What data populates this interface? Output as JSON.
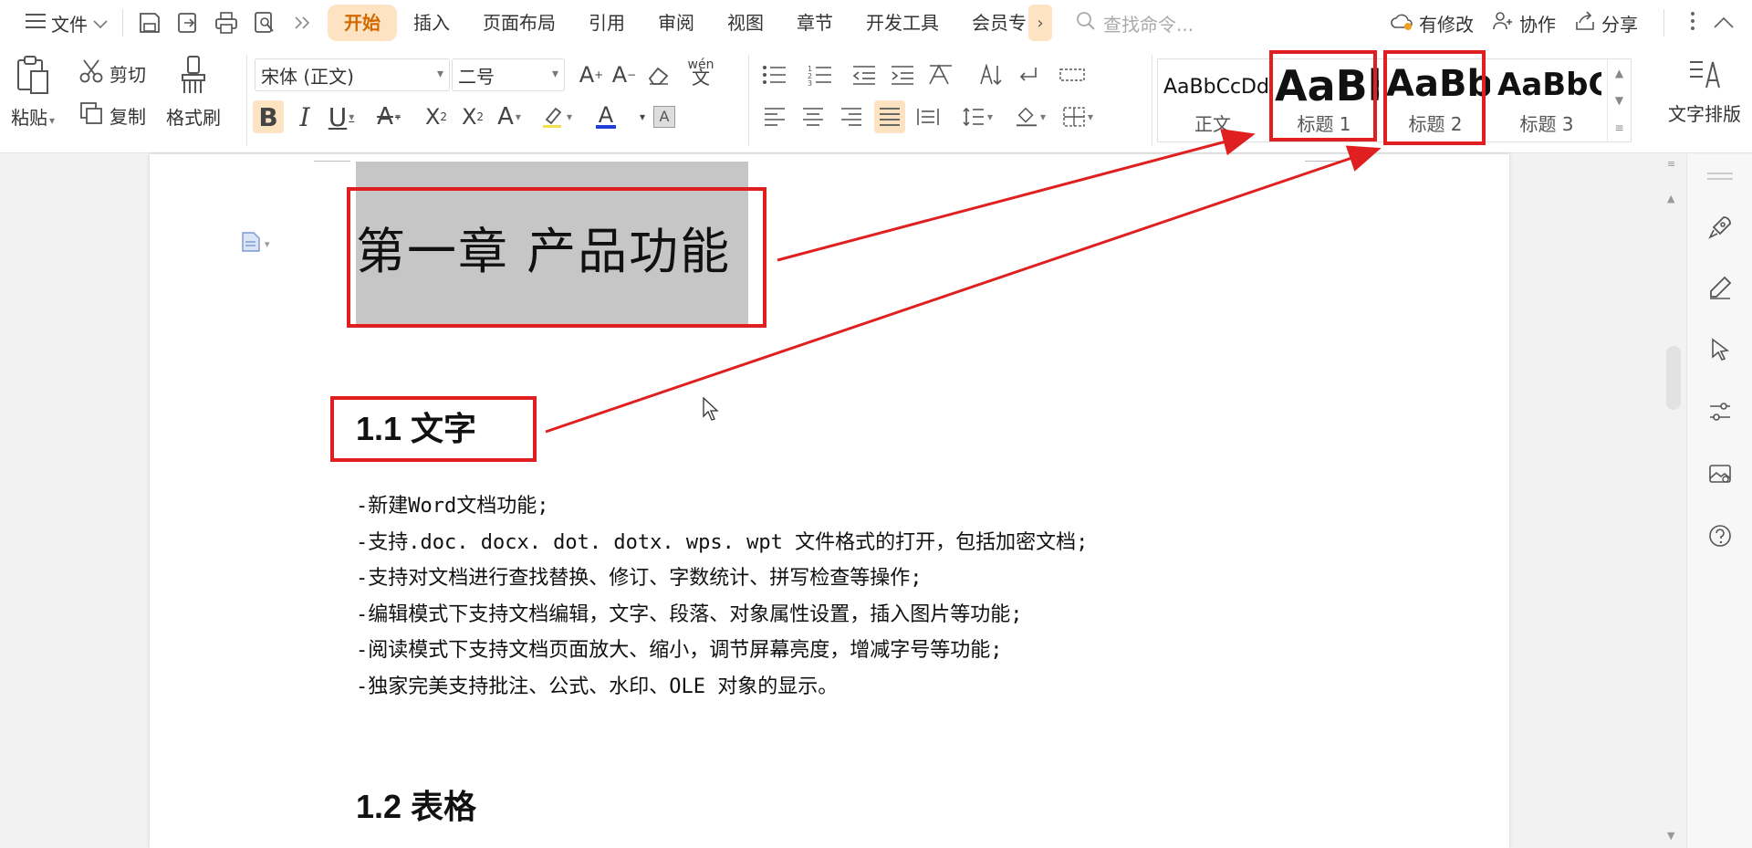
{
  "menubar": {
    "file_label": "文件",
    "tabs": [
      {
        "label": "开始",
        "active": true
      },
      {
        "label": "插入"
      },
      {
        "label": "页面布局"
      },
      {
        "label": "引用"
      },
      {
        "label": "审阅"
      },
      {
        "label": "视图"
      },
      {
        "label": "章节"
      },
      {
        "label": "开发工具"
      },
      {
        "label": "会员专"
      }
    ],
    "search_placeholder": "查找命令...",
    "right": {
      "changes_label": "有修改",
      "collab_label": "协作",
      "share_label": "分享"
    }
  },
  "ribbon": {
    "clipboard": {
      "paste_label": "粘贴",
      "cut_label": "剪切",
      "copy_label": "复制",
      "format_painter_label": "格式刷"
    },
    "font": {
      "font_family": "宋体 (正文)",
      "font_size": "二号",
      "pinyin_glyph": "wén"
    },
    "styles": [
      {
        "sample": "AaBbCcDd",
        "label": "正文"
      },
      {
        "sample": "AaBb",
        "label": "标题 1"
      },
      {
        "sample": "AaBb(",
        "label": "标题 2"
      },
      {
        "sample": "AaBbC",
        "label": "标题 3"
      }
    ],
    "text_layout_label": "文字排版"
  },
  "document": {
    "chapter_title": "第一章  产品功能",
    "section_1_title": "1.1  文字",
    "section_1_lines": [
      "-新建Word文档功能;",
      "-支持.doc. docx. dot. dotx. wps. wpt 文件格式的打开，包括加密文档;",
      "-支持对文档进行查找替换、修订、字数统计、拼写检查等操作;",
      "-编辑模式下支持文档编辑，文字、段落、对象属性设置，插入图片等功能;",
      "-阅读模式下支持文档页面放大、缩小，调节屏幕亮度，增减字号等功能;",
      "-独家完美支持批注、公式、水印、OLE 对象的显示。"
    ],
    "section_2_title": "1.2  表格"
  },
  "colors": {
    "accent_orange": "#d06a00",
    "active_tab_bg": "#fde3c2",
    "annotation_red": "#e02020",
    "selection_gray": "#c6c6c6"
  },
  "icons": [
    "hamburger-icon",
    "save-icon",
    "export-icon",
    "print-icon",
    "print-preview-icon",
    "more-icon",
    "search-icon",
    "cloud-icon",
    "collab-icon",
    "share-icon",
    "paste-icon",
    "scissors-icon",
    "copy-icon",
    "brush-icon",
    "rocket-icon",
    "pen-icon",
    "pointer-icon",
    "sliders-icon",
    "image-icon",
    "help-icon"
  ]
}
